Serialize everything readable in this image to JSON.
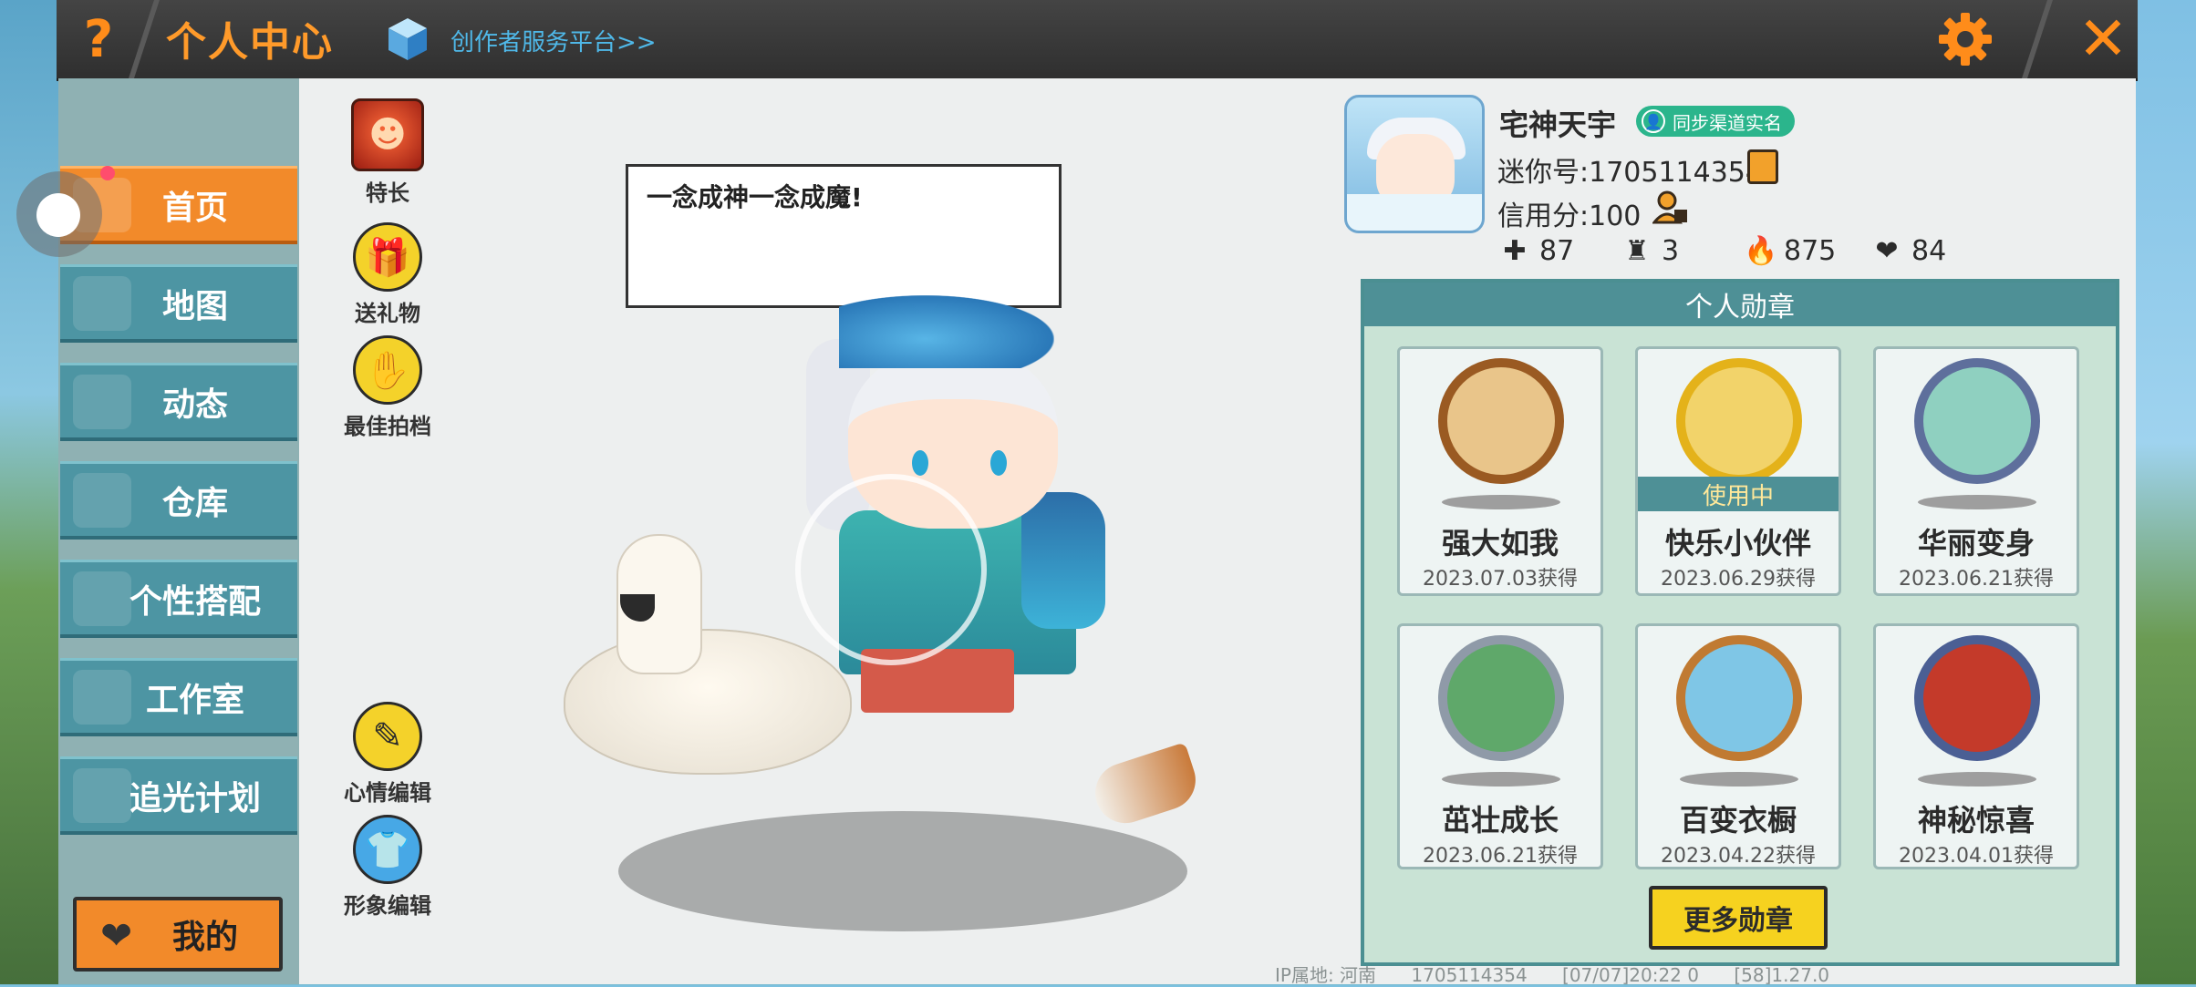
{
  "topbar": {
    "help_label": "?",
    "title": "个人中心",
    "creator_link": "创作者服务平台>>",
    "close_label": "✕"
  },
  "sidebar": {
    "items": [
      {
        "label": "首页",
        "active": true
      },
      {
        "label": "地图"
      },
      {
        "label": "动态"
      },
      {
        "label": "仓库"
      },
      {
        "label": "个性搭配"
      },
      {
        "label": "工作室"
      },
      {
        "label": "追光计划"
      }
    ],
    "mine_label": "我的"
  },
  "tools": {
    "specialty": "特长",
    "gift": "送礼物",
    "best_partner": "最佳拍档",
    "mood_edit": "心情编辑",
    "image_edit": "形象编辑"
  },
  "mood": {
    "text": "一念成神一念成魔!"
  },
  "profile": {
    "nickname": "宅神天宇",
    "realname_badge": "同步渠道实名",
    "mini_id": "迷你号:1705114354",
    "credit": "信用分:100",
    "stats": [
      {
        "icon": "bookmark-plus-icon",
        "value": "87"
      },
      {
        "icon": "podium-icon",
        "value": "3"
      },
      {
        "icon": "flame-icon",
        "value": "875"
      },
      {
        "icon": "hearts-icon",
        "value": "84"
      }
    ]
  },
  "badges": {
    "header": "个人勋章",
    "in_use_label": "使用中",
    "items": [
      {
        "name": "强大如我",
        "date": "2023.07.03获得",
        "color": "#d9a45a"
      },
      {
        "name": "快乐小伙伴",
        "date": "2023.06.29获得",
        "color": "#f2c230",
        "in_use": true
      },
      {
        "name": "华丽变身",
        "date": "2023.06.21获得",
        "color": "#5e6f9c"
      },
      {
        "name": "茁壮成长",
        "date": "2023.06.21获得",
        "color": "#8f9aa8"
      },
      {
        "name": "百变衣橱",
        "date": "2023.04.22获得",
        "color": "#d9a45a"
      },
      {
        "name": "神秘惊喜",
        "date": "2023.04.01获得",
        "color": "#4b5f94"
      }
    ],
    "more_label": "更多勋章"
  },
  "footer": {
    "ip": "IP属地: 河南",
    "uid": "1705114354",
    "time": "[07/07]20:22 0",
    "version": "[58]1.27.0"
  },
  "colors": {
    "accent_orange": "#f28a2a",
    "teal": "#4e9096",
    "yellow": "#f6d21f"
  }
}
